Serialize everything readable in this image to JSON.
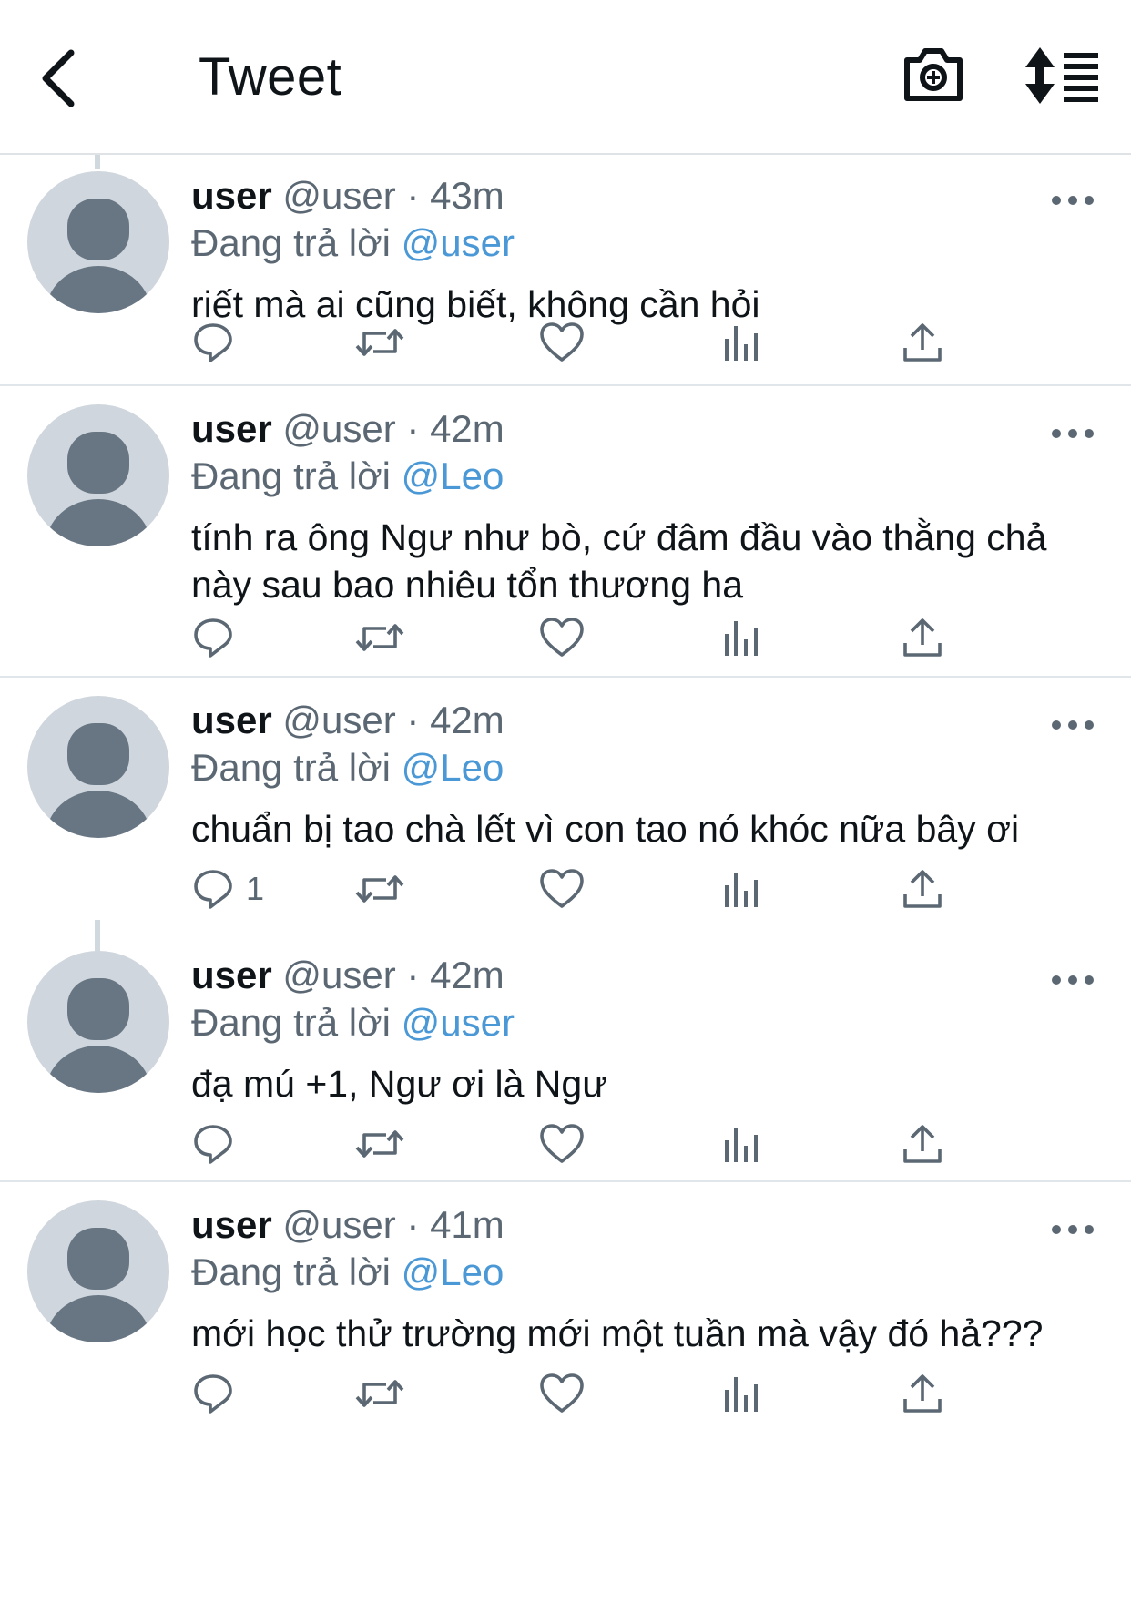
{
  "header": {
    "title": "Tweet",
    "back_icon": "back-arrow-icon",
    "camera_icon": "camera-add-icon",
    "sort_icon": "sort-icon"
  },
  "colors": {
    "mention": "#4a98d6",
    "secondary_text": "#5b6873",
    "avatar_bg": "#cfd6dd",
    "avatar_fg": "#687684"
  },
  "tweets": [
    {
      "name": "user",
      "handle": "@user",
      "time": "43m",
      "reply_prefix": "Đang trả lời",
      "reply_to": "@user",
      "text": "riết mà ai cũng biết, không cần hỏi",
      "reply_count": ""
    },
    {
      "name": "user",
      "handle": "@user",
      "time": "42m",
      "reply_prefix": "Đang trả lời",
      "reply_to": "@Leo",
      "text": "tính ra ông Ngư như bò, cứ đâm đầu vào thằng chả này sau bao nhiêu tổn thương ha",
      "reply_count": ""
    },
    {
      "name": "user",
      "handle": "@user",
      "time": "42m",
      "reply_prefix": "Đang trả lời",
      "reply_to": "@Leo",
      "text": "chuẩn bị tao chà lết vì con tao nó khóc nữa bây ơi",
      "reply_count": "1"
    },
    {
      "name": "user",
      "handle": "@user",
      "time": "42m",
      "reply_prefix": "Đang trả lời",
      "reply_to": "@user",
      "text": "đạ mú +1, Ngư ơi là Ngư",
      "reply_count": ""
    },
    {
      "name": "user",
      "handle": "@user",
      "time": "41m",
      "reply_prefix": "Đang trả lời",
      "reply_to": "@Leo",
      "text": "mới học thử trường mới một tuần mà vậy đó hả???",
      "reply_count": ""
    }
  ],
  "action_icons": [
    "reply-icon",
    "retweet-icon",
    "like-icon",
    "analytics-icon",
    "share-icon"
  ]
}
